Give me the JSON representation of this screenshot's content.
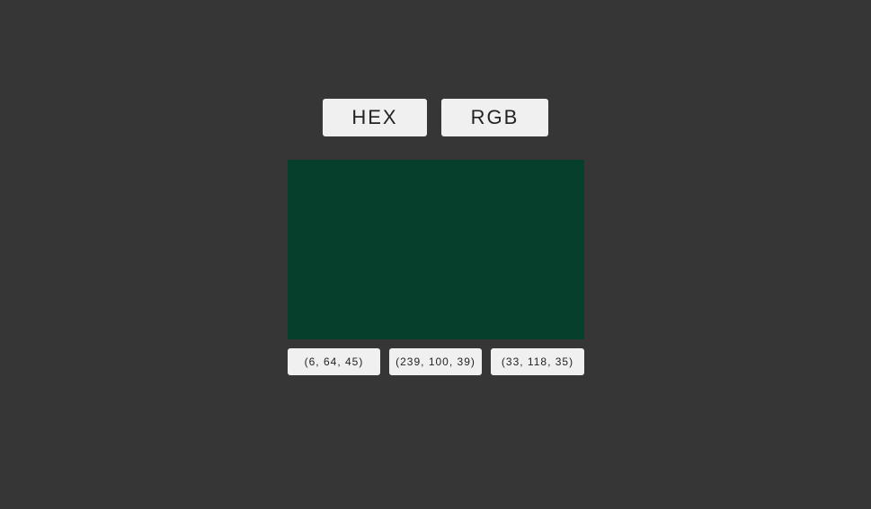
{
  "mode_buttons": {
    "hex_label": "HEX",
    "rgb_label": "RGB"
  },
  "swatch": {
    "color": "#06402d"
  },
  "options": [
    {
      "label": "(6, 64, 45)"
    },
    {
      "label": "(239, 100, 39)"
    },
    {
      "label": "(33, 118, 35)"
    }
  ],
  "colors": {
    "background": "#363636",
    "button_bg": "#f0f0f0",
    "button_text": "#222222"
  }
}
